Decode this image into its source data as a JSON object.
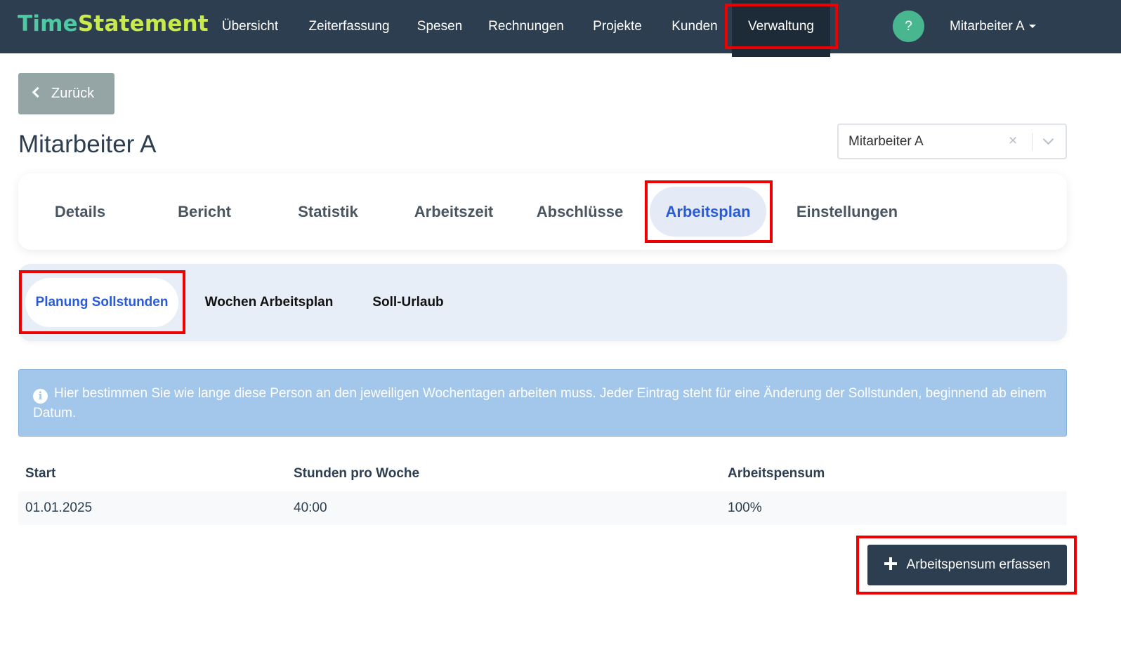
{
  "app": {
    "brand_part1": "Time",
    "brand_part2": "Statement",
    "brand_color_1": "#4ec9a2",
    "brand_color_2": "#c8ea4c"
  },
  "nav": {
    "items": [
      {
        "label": "Übersicht"
      },
      {
        "label": "Zeiterfassung"
      },
      {
        "label": "Spesen"
      },
      {
        "label": "Rechnungen"
      },
      {
        "label": "Projekte"
      },
      {
        "label": "Kunden"
      },
      {
        "label": "Verwaltung",
        "active": true
      }
    ],
    "help_label": "?",
    "user_label": "Mitarbeiter A"
  },
  "page": {
    "back_label": "Zurück",
    "title": "Mitarbeiter A",
    "employee_select_value": "Mitarbeiter A",
    "employee_select_clear": "×"
  },
  "tabs": [
    {
      "label": "Details"
    },
    {
      "label": "Bericht"
    },
    {
      "label": "Statistik"
    },
    {
      "label": "Arbeitszeit"
    },
    {
      "label": "Abschlüsse"
    },
    {
      "label": "Arbeitsplan",
      "active": true
    },
    {
      "label": "Einstellungen"
    }
  ],
  "subtabs": [
    {
      "label": "Planung Sollstunden",
      "active": true
    },
    {
      "label": "Wochen Arbeitsplan"
    },
    {
      "label": "Soll-Urlaub"
    }
  ],
  "info": {
    "icon": "info-icon",
    "icon_glyph": "i",
    "text": "Hier bestimmen Sie wie lange diese Person an den jeweiligen Wochentagen arbeiten muss. Jeder Eintrag steht für eine Änderung der Sollstunden, beginnend ab einem Datum."
  },
  "table": {
    "headers": [
      "Start",
      "Stunden pro Woche",
      "Arbeitspensum"
    ],
    "rows": [
      [
        "01.01.2025",
        "40:00",
        "100%"
      ]
    ]
  },
  "actions": {
    "add_label": "Arbeitspensum erfassen"
  },
  "colors": {
    "navbar": "#2c3e50",
    "accent": "#2a5bd7",
    "help": "#48b78f",
    "highlight": "#ee0000"
  }
}
